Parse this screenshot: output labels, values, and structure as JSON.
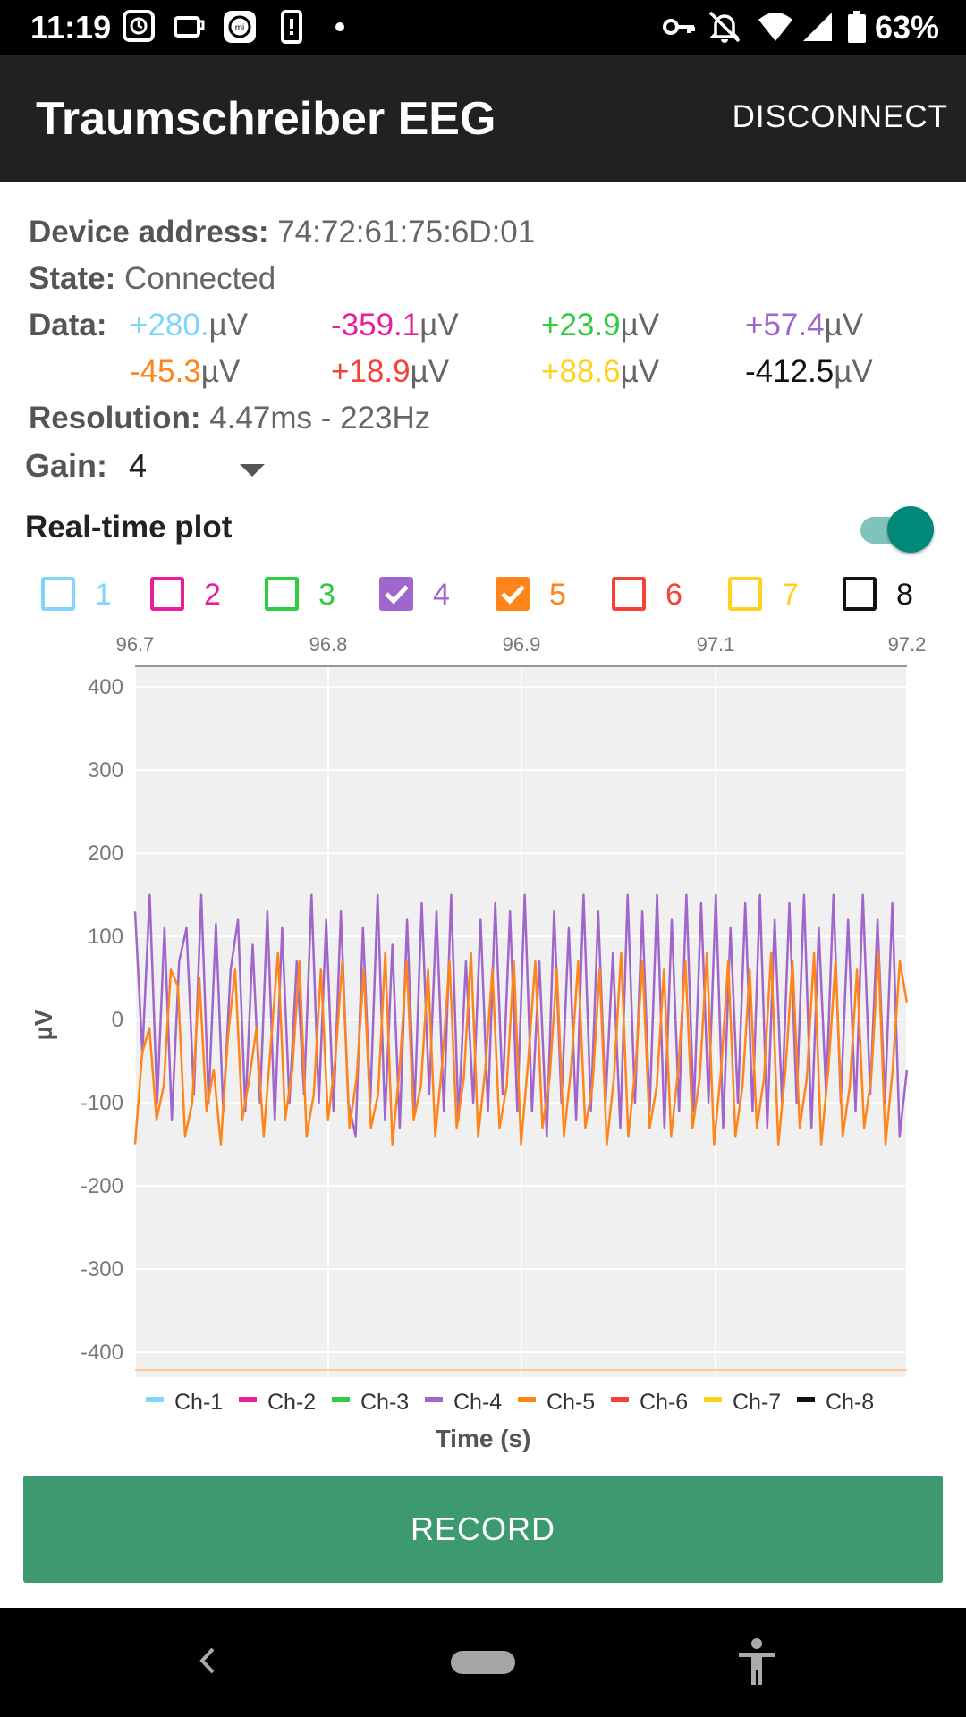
{
  "status_bar": {
    "time": "11:19",
    "battery_percent": "63%",
    "icons": [
      "clock-app-icon",
      "cup-icon",
      "mi-fit-icon",
      "phone-alert-icon",
      "dot-icon",
      "key-icon",
      "bell-off-icon",
      "wifi-icon",
      "signal-icon",
      "battery-icon"
    ]
  },
  "app_bar": {
    "title": "Traumschreiber EEG",
    "action": "DISCONNECT"
  },
  "info": {
    "device_address_label": "Device address:",
    "device_address": "74:72:61:75:6D:01",
    "state_label": "State:",
    "state": "Connected",
    "data_label": "Data:",
    "unit": "µV",
    "resolution_label": "Resolution:",
    "resolution": "4.47ms - 223Hz",
    "data": [
      {
        "value": "+280.",
        "color": "#81d4fa"
      },
      {
        "value": "-359.1",
        "color": "#e91e9c"
      },
      {
        "value": "+23.9",
        "color": "#2ecc40"
      },
      {
        "value": "+57.4",
        "color": "#a066cc"
      },
      {
        "value": "-45.3",
        "color": "#ff851b"
      },
      {
        "value": "+18.9",
        "color": "#f44336"
      },
      {
        "value": "+88.6",
        "color": "#ffd21f"
      },
      {
        "value": "-412.5",
        "color": "#111111"
      }
    ]
  },
  "gain": {
    "label": "Gain:",
    "value": "4"
  },
  "realtime": {
    "label": "Real-time plot",
    "enabled": true
  },
  "channels": [
    {
      "label": "1",
      "color": "#81d4fa",
      "checked": false
    },
    {
      "label": "2",
      "color": "#e91e9c",
      "checked": false
    },
    {
      "label": "3",
      "color": "#2ecc40",
      "checked": false
    },
    {
      "label": "4",
      "color": "#a066cc",
      "checked": true
    },
    {
      "label": "5",
      "color": "#ff851b",
      "checked": true
    },
    {
      "label": "6",
      "color": "#f44336",
      "checked": false
    },
    {
      "label": "7",
      "color": "#ffd21f",
      "checked": false
    },
    {
      "label": "8",
      "color": "#111111",
      "checked": false
    }
  ],
  "chart_data": {
    "type": "line",
    "xlabel": "Time (s)",
    "ylabel": "µV",
    "x_ticks": [
      "96.7",
      "96.8",
      "96.9",
      "97.1",
      "97.2"
    ],
    "y_ticks": [
      "400",
      "300",
      "200",
      "100",
      "0",
      "-100",
      "-200",
      "-300",
      "-400"
    ],
    "ylim": [
      -430,
      425
    ],
    "grid": true,
    "legend_position": "bottom",
    "legend": [
      {
        "name": "Ch-1",
        "color": "#81d4fa"
      },
      {
        "name": "Ch-2",
        "color": "#e91e9c"
      },
      {
        "name": "Ch-3",
        "color": "#2ecc40"
      },
      {
        "name": "Ch-4",
        "color": "#a066cc"
      },
      {
        "name": "Ch-5",
        "color": "#ff851b"
      },
      {
        "name": "Ch-6",
        "color": "#f44336"
      },
      {
        "name": "Ch-7",
        "color": "#ffd21f"
      },
      {
        "name": "Ch-8",
        "color": "#111111"
      }
    ],
    "series": [
      {
        "name": "Ch-4",
        "color": "#a066cc",
        "values": [
          130,
          -40,
          150,
          -100,
          110,
          -120,
          70,
          110,
          -90,
          150,
          -100,
          115,
          -110,
          60,
          120,
          -110,
          90,
          -100,
          130,
          -120,
          110,
          -100,
          70,
          -90,
          150,
          -100,
          120,
          -110,
          130,
          -100,
          -140,
          110,
          -100,
          150,
          -120,
          90,
          -130,
          120,
          -110,
          140,
          -90,
          130,
          -110,
          150,
          -120,
          70,
          -100,
          120,
          -110,
          140,
          -90,
          130,
          -110,
          150,
          -110,
          70,
          -140,
          130,
          -100,
          110,
          -120,
          150,
          -110,
          130,
          -100,
          80,
          -130,
          150,
          -100,
          130,
          -110,
          150,
          -130,
          120,
          -110,
          150,
          -110,
          140,
          -100,
          150,
          -130,
          110,
          -100,
          140,
          -110,
          150,
          -130,
          120,
          -100,
          140,
          -100,
          150,
          -130,
          110,
          -90,
          150,
          -100,
          120,
          -110,
          150,
          -90,
          120,
          -100,
          140,
          -140,
          -60
        ]
      },
      {
        "name": "Ch-5",
        "color": "#ff851b",
        "values": [
          -150,
          -40,
          -10,
          -120,
          -80,
          60,
          40,
          -140,
          -100,
          50,
          -110,
          -60,
          -150,
          -20,
          60,
          -120,
          -70,
          -10,
          -140,
          -30,
          80,
          -120,
          -60,
          70,
          -140,
          -90,
          60,
          -120,
          -50,
          70,
          -130,
          -70,
          60,
          -130,
          -90,
          80,
          -150,
          -60,
          70,
          -120,
          -80,
          60,
          -140,
          -50,
          70,
          -130,
          -70,
          80,
          -140,
          -60,
          60,
          -130,
          -80,
          70,
          -150,
          -50,
          70,
          -130,
          -70,
          60,
          -140,
          -60,
          70,
          -130,
          -80,
          60,
          -150,
          -70,
          80,
          -140,
          -60,
          70,
          -130,
          -80,
          60,
          -140,
          -60,
          70,
          -130,
          -70,
          80,
          -150,
          -60,
          70,
          -140,
          -80,
          60,
          -130,
          -70,
          80,
          -150,
          -60,
          70,
          -130,
          -70,
          80,
          -150,
          -60,
          70,
          -140,
          -80,
          60,
          -130,
          -70,
          80,
          -150,
          -60,
          70,
          20
        ]
      }
    ]
  },
  "record_button": {
    "label": "RECORD"
  }
}
